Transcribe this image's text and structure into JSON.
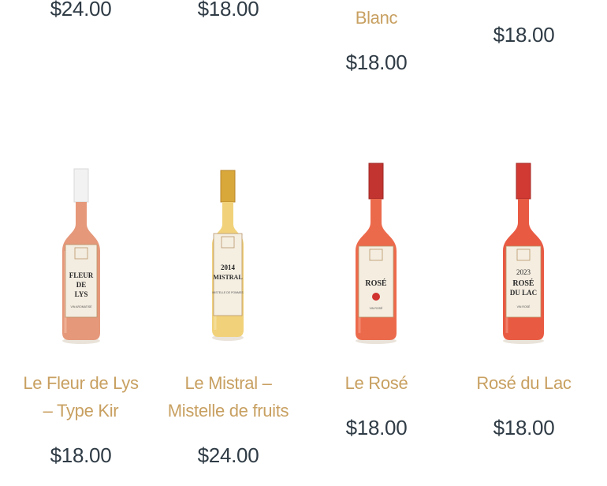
{
  "top_row": {
    "prices": [
      "$24.00",
      "$18.00",
      "$18.00",
      "$18.00"
    ],
    "partial_title_tail": "Blanc"
  },
  "products": [
    {
      "name": "Le Fleur de Lys – Type Kir",
      "name_line1": "Le Fleur de Lys",
      "name_line2": "– Type Kir",
      "price": "$18.00",
      "label": {
        "line1": "FLEUR",
        "line2": "DE",
        "line3": "LYS",
        "small": "VIN AROMATISÉ"
      },
      "colors": {
        "liquid": "#e5987a",
        "cap": "#f2f2f2",
        "label": "#f3ece0"
      }
    },
    {
      "name": "Le Mistral – Mistelle de fruits",
      "name_line1": "Le Mistral –",
      "name_line2": "Mistelle de fruits",
      "price": "$24.00",
      "label": {
        "line1": "2014",
        "line2": "MISTRAL",
        "small": "MISTELLE DE POMMES"
      },
      "colors": {
        "liquid": "#f1d27a",
        "cap": "#d9a83a",
        "label": "#f5efe2"
      }
    },
    {
      "name": "Le Rosé",
      "name_line1": "Le Rosé",
      "price": "$18.00",
      "label": {
        "line1": "ROSÉ",
        "small": "VIN ROSÉ"
      },
      "colors": {
        "liquid": "#ec6a4c",
        "cap": "#c23430",
        "label": "#f4ede0"
      }
    },
    {
      "name": "Rosé du Lac",
      "name_line1": "Rosé du Lac",
      "price": "$18.00",
      "label": {
        "line1": "2023",
        "line2": "ROSÉ",
        "line3": "DU LAC",
        "small": "VIN ROSÉ"
      },
      "colors": {
        "liquid": "#e95a43",
        "cap": "#d03a33",
        "label": "#f4ede0"
      }
    }
  ],
  "theme": {
    "title_color": "#c8a061",
    "price_color": "#2f3b45"
  }
}
